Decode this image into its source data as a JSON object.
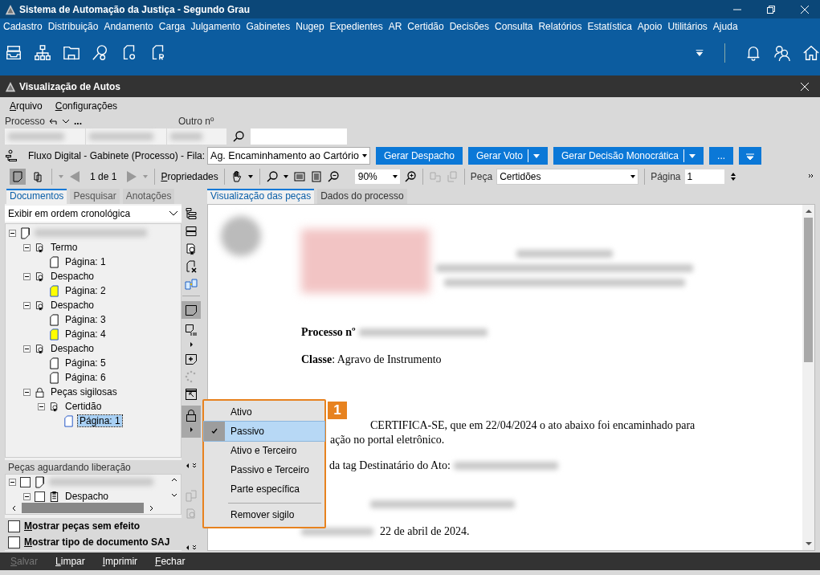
{
  "window": {
    "title": "Sistema de Automação da Justiça - Segundo Grau"
  },
  "menu_bar": [
    "Cadastro",
    "Distribuição",
    "Andamento",
    "Carga",
    "Julgamento",
    "Gabinetes",
    "Nugep",
    "Expedientes",
    "AR",
    "Certidão",
    "Decisões",
    "Consulta",
    "Relatórios",
    "Estatística",
    "Apoio",
    "Utilitários",
    "Ajuda"
  ],
  "subwindow": {
    "title": "Visualização de Autos"
  },
  "sub_menu": [
    "Arquivo",
    "Configurações"
  ],
  "process": {
    "label": "Processo",
    "more": "...",
    "other_label": "Outro nº"
  },
  "flow": {
    "label": "Fluxo Digital - Gabinete (Processo) - Fila:",
    "queue": "Ag. Encaminhamento ao Cartório"
  },
  "actions": [
    {
      "label": "Gerar Despacho",
      "split": false
    },
    {
      "label": "Gerar Voto",
      "split": true
    },
    {
      "label": "Gerar Decisão Monocrática",
      "split": true
    },
    {
      "label": "...",
      "split": false
    }
  ],
  "viewer_toolbar": {
    "pages": "1 de 1",
    "properties": "Propriedades",
    "zoom": "90%",
    "piece_label": "Peça",
    "piece": "Certidões",
    "page_label": "Página",
    "page": "1"
  },
  "left_tabs": [
    {
      "label": "Documentos",
      "selected": true
    },
    {
      "label": "Pesquisar",
      "selected": false
    },
    {
      "label": "Anotações",
      "selected": false
    }
  ],
  "view_tabs": [
    {
      "label": "Visualização das peças",
      "selected": true
    },
    {
      "label": "Dados do processo",
      "selected": false
    }
  ],
  "order": "Exibir em ordem cronológica",
  "tree": {
    "children": [
      {
        "kind": "document",
        "label": "Termo",
        "expanded": true,
        "children": [
          {
            "kind": "page",
            "label": "Página: 1",
            "highlighted": false,
            "selected": false
          }
        ]
      },
      {
        "kind": "document",
        "label": "Despacho",
        "expanded": true,
        "children": [
          {
            "kind": "page",
            "label": "Página: 2",
            "highlighted": true,
            "selected": false
          }
        ]
      },
      {
        "kind": "document",
        "label": "Despacho",
        "expanded": true,
        "children": [
          {
            "kind": "page",
            "label": "Página: 3",
            "highlighted": false,
            "selected": false
          },
          {
            "kind": "page",
            "label": "Página: 4",
            "highlighted": true,
            "selected": false
          }
        ]
      },
      {
        "kind": "document",
        "label": "Despacho",
        "expanded": true,
        "children": [
          {
            "kind": "page",
            "label": "Página: 5",
            "highlighted": false,
            "selected": false
          },
          {
            "kind": "page",
            "label": "Página: 6",
            "highlighted": false,
            "selected": false
          }
        ]
      },
      {
        "kind": "locked",
        "label": "Peças sigilosas",
        "expanded": true,
        "children": [
          {
            "kind": "document",
            "label": "Certidão",
            "expanded": true,
            "children": [
              {
                "kind": "page",
                "label": "Página: 1",
                "highlighted": false,
                "selected": true
              }
            ]
          }
        ]
      }
    ]
  },
  "pending": {
    "title": "Peças aguardando liberação",
    "checked": false,
    "children": [
      {
        "label": "Despacho",
        "checked": false
      }
    ]
  },
  "options": [
    {
      "label": "Mostrar peças sem efeito",
      "checked": false
    },
    {
      "label": "Mostrar tipo de documento SAJ",
      "checked": false
    }
  ],
  "document": {
    "process_label": "Processo nº",
    "class_line": "**Classe**: Agravo de Instrumento",
    "certify": "CERTIFICA-SE, que em 22/04/2024 o ato abaixo foi encaminhado para",
    "certify_cont": "ação no portal eletrônico.",
    "tag_line": "da tag Destinatário do Ato:",
    "date": "22 de abril de 2024."
  },
  "context_menu": {
    "badge": "1",
    "items": [
      {
        "label": "Ativo",
        "checked": false,
        "selected": false,
        "separator": false
      },
      {
        "label": "Passivo",
        "checked": true,
        "selected": true,
        "separator": false
      },
      {
        "label": "Ativo e Terceiro",
        "checked": false,
        "selected": false,
        "separator": false
      },
      {
        "label": "Passivo e Terceiro",
        "checked": false,
        "selected": false,
        "separator": false
      },
      {
        "label": "Parte específica",
        "checked": false,
        "selected": false,
        "separator": false
      },
      {
        "label": "Remover sigilo",
        "checked": false,
        "selected": false,
        "separator": true
      }
    ]
  },
  "bottom_bar": [
    {
      "label": "Salvar",
      "disabled": true
    },
    {
      "label": "Limpar",
      "disabled": false
    },
    {
      "label": "Imprimir",
      "disabled": false
    },
    {
      "label": "Fechar",
      "disabled": false
    }
  ]
}
